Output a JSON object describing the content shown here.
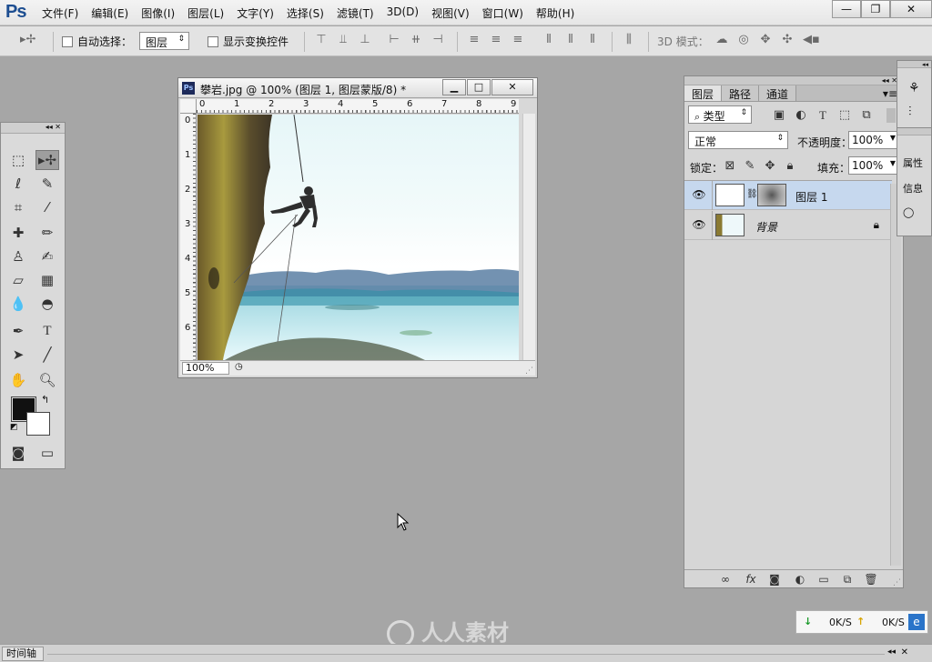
{
  "app": {
    "logo": "Ps"
  },
  "menu": [
    "文件(F)",
    "编辑(E)",
    "图像(I)",
    "图层(L)",
    "文字(Y)",
    "选择(S)",
    "滤镜(T)",
    "3D(D)",
    "视图(V)",
    "窗口(W)",
    "帮助(H)"
  ],
  "window_controls": {
    "minimize": "—",
    "restore": "❐",
    "close": "✕"
  },
  "options_bar": {
    "auto_select_label": "自动选择：",
    "auto_select_target": "图层",
    "show_transform_label": "显示变换控件",
    "mode_3d_label": "3D 模式："
  },
  "document": {
    "title": "攀岩.jpg @ 100% (图层 1, 图层蒙版/8) *",
    "zoom": "100%",
    "ruler_top": [
      "0",
      "1",
      "2",
      "3",
      "4",
      "5",
      "6",
      "7",
      "8",
      "9"
    ],
    "ruler_left": [
      "0",
      "1",
      "2",
      "3",
      "4",
      "5",
      "6"
    ],
    "btn_min": "▁",
    "btn_max": "□",
    "btn_close": "✕"
  },
  "layers_panel": {
    "tabs": [
      "图层",
      "路径",
      "通道"
    ],
    "filter_kind": "类型",
    "blend_mode": "正常",
    "opacity_label": "不透明度：",
    "opacity_value": "100%",
    "lock_label": "锁定：",
    "fill_label": "填充：",
    "fill_value": "100%",
    "layers": [
      {
        "name": "图层 1",
        "selected": true
      },
      {
        "name": "背景",
        "selected": false
      }
    ],
    "footer_icons": [
      "link-icon",
      "fx-icon",
      "mask-icon",
      "adjustment-icon",
      "folder-icon",
      "new-layer-icon",
      "trash-icon"
    ]
  },
  "dock": {
    "item1": "属性",
    "item2": "信息"
  },
  "netspeed": {
    "down": "0K/S",
    "up": "0K/S"
  },
  "timeline": {
    "label": "时间轴"
  },
  "watermark": "人人素材"
}
